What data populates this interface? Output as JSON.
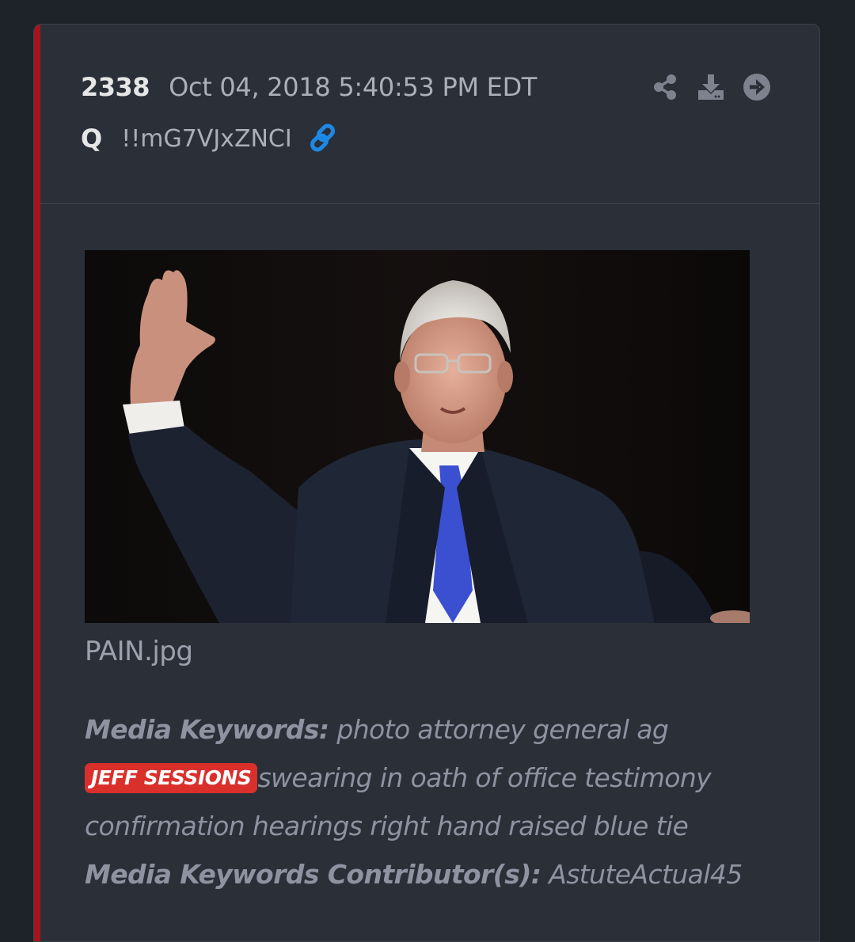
{
  "post": {
    "number": "2338",
    "date": "Oct 04, 2018 5:40:53 PM EDT",
    "author": "Q",
    "tripcode": "!!mG7VJxZNCI"
  },
  "actions": {
    "icons": [
      "share-icon",
      "download-icon",
      "arrow-right-circle-icon"
    ]
  },
  "media": {
    "filename": "PAIN.jpg"
  },
  "keywords": {
    "label": "Media Keywords:",
    "text_before": "photo attorney general ag",
    "tag": "JEFF SESSIONS",
    "text_after": "swearing in oath of office testimony confirmation hearings right hand raised blue tie",
    "contributor_label": "Media Keywords Contributor(s):",
    "contributor": "AstuteActual45"
  },
  "colors": {
    "accent": "#a4161a",
    "tag_bg": "#d9302c",
    "link": "#1e88e5",
    "background": "#1e2229",
    "card": "#2a2f38"
  }
}
